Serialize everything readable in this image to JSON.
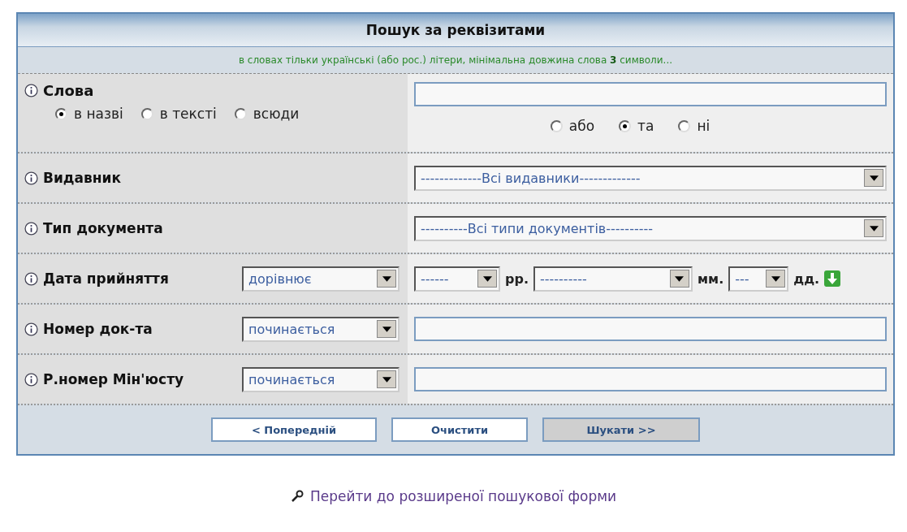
{
  "title": "Пошук за реквізитами",
  "hint": "в словах тільки українські (або рос.) літери, мінімальна довжина слова **3** символи...",
  "rows": [
    {
      "kind": "words",
      "label": "Слова",
      "scopes": [
        {
          "label": "в назві",
          "selected": true
        },
        {
          "label": "в тексті",
          "selected": false
        },
        {
          "label": "всюди",
          "selected": false
        }
      ],
      "value": "",
      "logic": [
        {
          "label": "або",
          "selected": false
        },
        {
          "label": "та",
          "selected": true
        },
        {
          "label": "ні",
          "selected": false
        }
      ]
    },
    {
      "kind": "select",
      "label": "Видавник",
      "value": "-------------Всі видавники-------------"
    },
    {
      "kind": "select",
      "label": "Тип документа",
      "value": "----------Всі типи документів----------"
    },
    {
      "kind": "date",
      "label": "Дата прийняття",
      "op": "дорівнює",
      "parts": [
        {
          "value": "------",
          "unit": "рр."
        },
        {
          "value": "----------",
          "unit": "мм."
        },
        {
          "value": "---",
          "unit": "дд."
        }
      ]
    },
    {
      "kind": "text",
      "label": "Номер док-та",
      "op": "починається",
      "value": ""
    },
    {
      "kind": "text",
      "label": "Р.номер Мін'юсту",
      "op": "починається",
      "value": ""
    }
  ],
  "buttons": [
    {
      "label": "< Попередній",
      "pressed": false
    },
    {
      "label": "Очистити",
      "pressed": false
    },
    {
      "label": "Шукати >>",
      "pressed": true
    }
  ],
  "link": "Перейти до розширеної пошукової форми"
}
